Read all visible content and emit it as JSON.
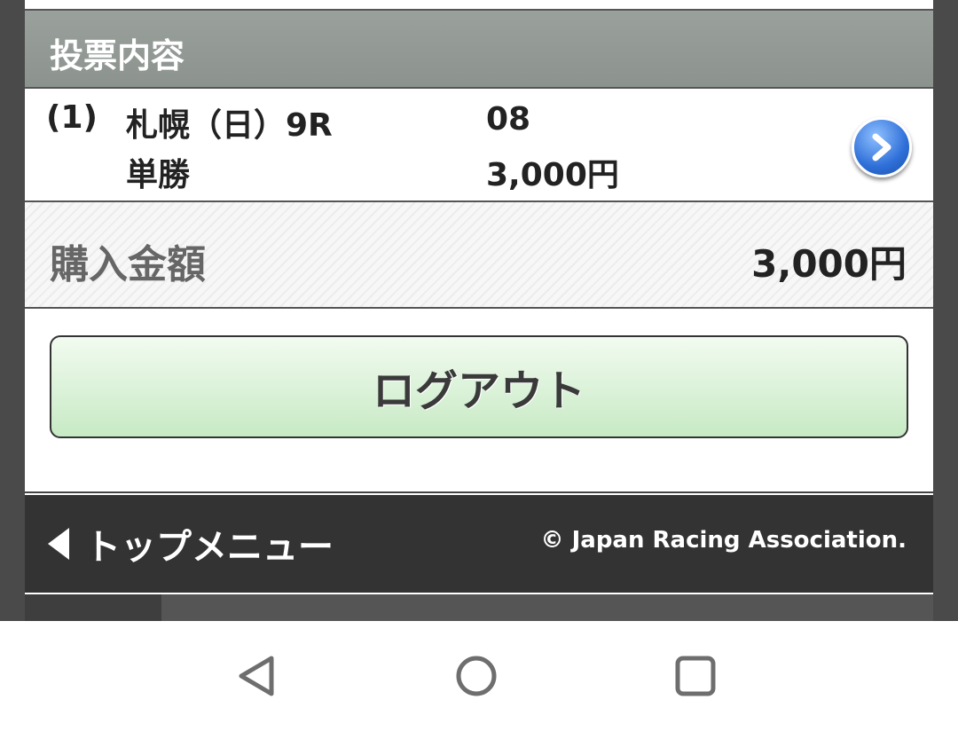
{
  "section": {
    "title": "投票内容"
  },
  "vote": {
    "index": "(1)",
    "race": "札幌（日）9R",
    "bet_type": "単勝",
    "horse_number": "08",
    "amount": "3,000円",
    "detail_icon": "chevron-right-icon"
  },
  "total": {
    "label": "購入金額",
    "value": "3,000円"
  },
  "logout": {
    "label": "ログアウト"
  },
  "footer": {
    "top_menu_label": "トップメニュー",
    "copyright": "© Japan Racing Association."
  },
  "navbar": {
    "icons": [
      "back-triangle-icon",
      "home-circle-icon",
      "recent-square-icon"
    ]
  },
  "colors": {
    "header_bg": "#8f9691",
    "footer_bg": "#333333",
    "logout_top": "#f2fbf0",
    "logout_bottom": "#c7eac4",
    "detail_blue": "#2e6fd8"
  }
}
